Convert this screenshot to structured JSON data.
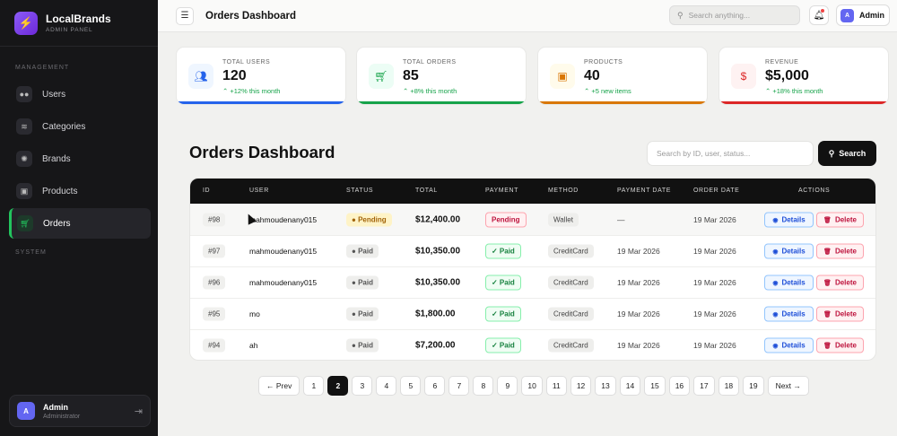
{
  "brand": {
    "name": "LocalBrands",
    "subtitle": "ADMIN PANEL",
    "logo_icon": "lightning-icon"
  },
  "sidebar": {
    "section_management": "MANAGEMENT",
    "section_system": "SYSTEM",
    "items": [
      {
        "label": "Users",
        "icon": "users-icon"
      },
      {
        "label": "Categories",
        "icon": "layers-icon"
      },
      {
        "label": "Brands",
        "icon": "badge-icon"
      },
      {
        "label": "Products",
        "icon": "box-icon"
      },
      {
        "label": "Orders",
        "icon": "cart-icon",
        "active": true
      }
    ],
    "user": {
      "initial": "A",
      "name": "Admin",
      "role": "Administrator"
    }
  },
  "topbar": {
    "title": "Orders Dashboard",
    "search_placeholder": "Search anything...",
    "admin_initial": "A",
    "admin_name": "Admin"
  },
  "stats": [
    {
      "label": "TOTAL USERS",
      "value": "120",
      "trend": "+12% this month",
      "accent": "#2563eb",
      "icon": "users-icon"
    },
    {
      "label": "TOTAL ORDERS",
      "value": "85",
      "trend": "+8% this month",
      "accent": "#16a34a",
      "icon": "cart-icon"
    },
    {
      "label": "PRODUCTS",
      "value": "40",
      "trend": "+5 new items",
      "accent": "#d97706",
      "icon": "box-icon"
    },
    {
      "label": "REVENUE",
      "value": "$5,000",
      "trend": "+18% this month",
      "accent": "#dc2626",
      "icon": "dollar-icon"
    }
  ],
  "main": {
    "title": "Orders Dashboard",
    "search_placeholder": "Search by ID, user, status...",
    "search_button": "Search"
  },
  "table": {
    "headers": {
      "id": "ID",
      "user": "USER",
      "status": "STATUS",
      "total": "TOTAL",
      "payment": "PAYMENT",
      "method": "METHOD",
      "payment_date": "PAYMENT DATE",
      "order_date": "ORDER DATE",
      "actions": "ACTIONS"
    },
    "details_label": "Details",
    "delete_label": "Delete",
    "rows": [
      {
        "id": "#98",
        "user": "mahmoudenany015",
        "status": "Pending",
        "total": "$12,400.00",
        "payment": "Pending",
        "method": "Wallet",
        "payment_date": "—",
        "order_date": "19 Mar 2026"
      },
      {
        "id": "#97",
        "user": "mahmoudenany015",
        "status": "Paid",
        "total": "$10,350.00",
        "payment": "✓ Paid",
        "method": "CreditCard",
        "payment_date": "19 Mar 2026",
        "order_date": "19 Mar 2026"
      },
      {
        "id": "#96",
        "user": "mahmoudenany015",
        "status": "Paid",
        "total": "$10,350.00",
        "payment": "✓ Paid",
        "method": "CreditCard",
        "payment_date": "19 Mar 2026",
        "order_date": "19 Mar 2026"
      },
      {
        "id": "#95",
        "user": "mo",
        "status": "Paid",
        "total": "$1,800.00",
        "payment": "✓ Paid",
        "method": "CreditCard",
        "payment_date": "19 Mar 2026",
        "order_date": "19 Mar 2026"
      },
      {
        "id": "#94",
        "user": "ah",
        "status": "Paid",
        "total": "$7,200.00",
        "payment": "✓ Paid",
        "method": "CreditCard",
        "payment_date": "19 Mar 2026",
        "order_date": "19 Mar 2026"
      }
    ]
  },
  "pagination": {
    "prev": "← Prev",
    "next": "Next →",
    "pages": [
      "1",
      "2",
      "3",
      "4",
      "5",
      "6",
      "7",
      "8",
      "9",
      "10",
      "11",
      "12",
      "13",
      "14",
      "15",
      "16",
      "17",
      "18",
      "19"
    ],
    "current": "2"
  }
}
